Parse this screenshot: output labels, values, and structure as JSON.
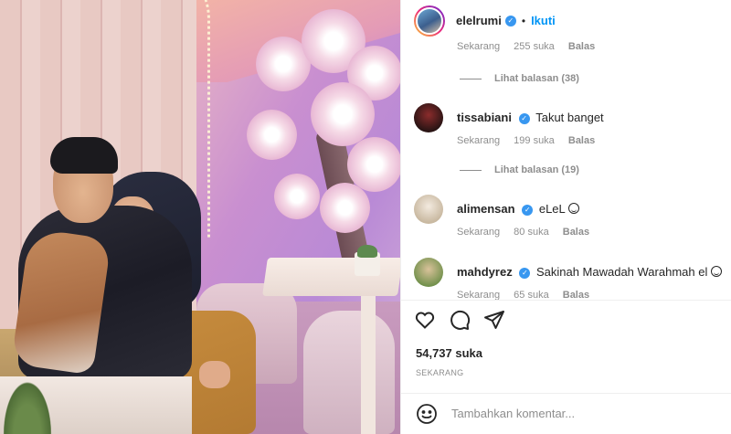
{
  "header": {
    "username": "elelrumi",
    "separator": "•",
    "follow_label": "Ikuti",
    "verified_icon": "verified-badge-icon"
  },
  "comments": {
    "top_partial": {
      "time": "Sekarang",
      "likes": "255 suka",
      "reply": "Balas"
    },
    "view_replies_1": "Lihat balasan (38)",
    "items": [
      {
        "username": "tissabiani",
        "text": "Takut banget",
        "time": "Sekarang",
        "likes": "199 suka",
        "reply": "Balas"
      },
      {
        "username": "alimensan",
        "text": "eLeL",
        "time": "Sekarang",
        "likes": "80 suka",
        "reply": "Balas"
      },
      {
        "username": "mahdyrez",
        "text": "Sakinah Mawadah Warahmah el",
        "time": "Sekarang",
        "likes": "65 suka",
        "reply": "Balas"
      }
    ],
    "view_replies_2": "Lihat balasan (19)"
  },
  "actions": {
    "icons": [
      "heart-icon",
      "comment-icon",
      "share-icon"
    ]
  },
  "likes_label": "54,737 suka",
  "timestamp": "SEKARANG",
  "add_comment": {
    "placeholder": "Tambahkan komentar...",
    "emoji_icon": "emoji-icon"
  },
  "colors": {
    "accent": "#0095f6",
    "verified": "#3897f0",
    "muted": "#8e8e8e",
    "text": "#262626"
  }
}
